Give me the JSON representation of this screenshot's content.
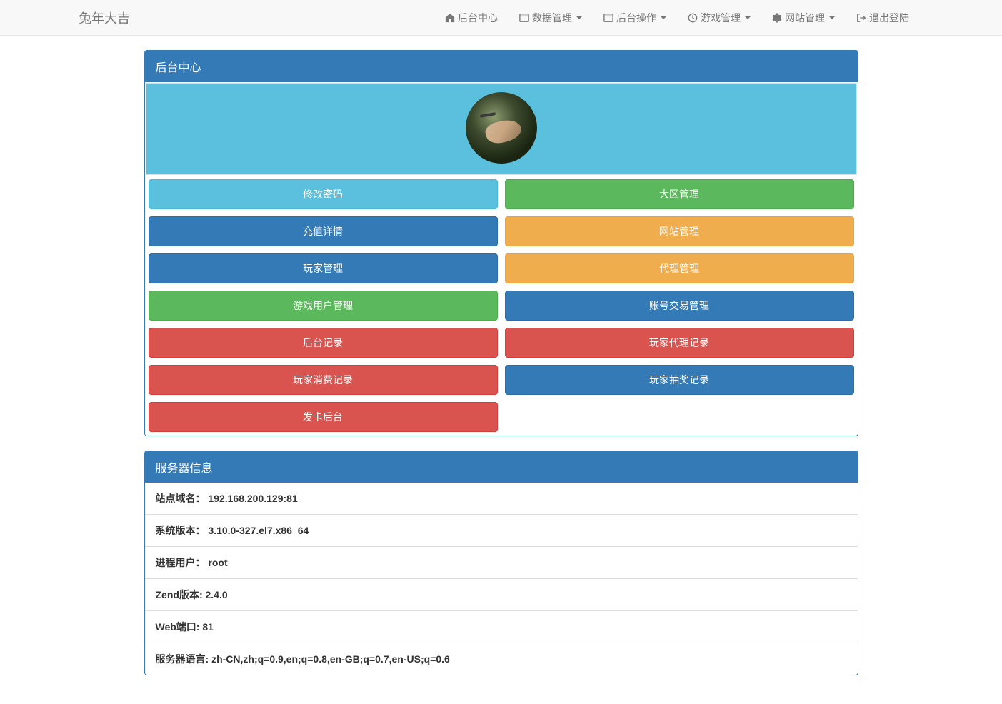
{
  "brand": "兔年大吉",
  "nav": {
    "home": "后台中心",
    "data_mgmt": "数据管理",
    "backend_ops": "后台操作",
    "game_mgmt": "游戏管理",
    "site_mgmt": "网站管理",
    "logout": "退出登陆"
  },
  "panel1": {
    "title": "后台中心",
    "buttons": {
      "change_password": "修改密码",
      "region_mgmt": "大区管理",
      "recharge_details": "充值详情",
      "site_mgmt": "网站管理",
      "player_mgmt": "玩家管理",
      "agent_mgmt": "代理管理",
      "game_user_mgmt": "游戏用户管理",
      "account_trade_mgmt": "账号交易管理",
      "backend_log": "后台记录",
      "player_agent_log": "玩家代理记录",
      "player_consume_log": "玩家消费记录",
      "player_lottery_log": "玩家抽奖记录",
      "card_backend": "发卡后台"
    }
  },
  "panel2": {
    "title": "服务器信息",
    "items": [
      {
        "label": "站点域名：",
        "value": "192.168.200.129:81"
      },
      {
        "label": "系统版本：",
        "value": "3.10.0-327.el7.x86_64"
      },
      {
        "label": "进程用户：",
        "value": "root"
      },
      {
        "label": "Zend版本: ",
        "value": "2.4.0"
      },
      {
        "label": "Web端口: ",
        "value": "81"
      },
      {
        "label": "服务器语言: ",
        "value": "zh-CN,zh;q=0.9,en;q=0.8,en-GB;q=0.7,en-US;q=0.6"
      }
    ]
  }
}
